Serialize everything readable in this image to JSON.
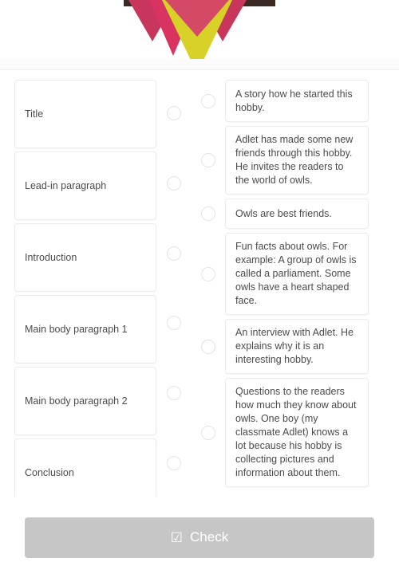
{
  "hero": {
    "image_alt": "party-bunting-banner-image",
    "colors": {
      "bar": "#3b2a23",
      "pennant_pink": "#c9365c",
      "pennant_pink_light": "#d44a66",
      "pennant_yellow": "#d7d128"
    }
  },
  "exercise": {
    "left_items": [
      {
        "label": "Title"
      },
      {
        "label": "Lead-in paragraph"
      },
      {
        "label": "Introduction"
      },
      {
        "label": "Main body paragraph 1"
      },
      {
        "label": "Main body paragraph 2"
      },
      {
        "label": "Conclusion"
      }
    ],
    "right_items": [
      {
        "label": "A story how he started this hobby."
      },
      {
        "label": "Adlet has made some new friends through this hobby. He invites the readers to the world of owls."
      },
      {
        "label": "Owls are best friends."
      },
      {
        "label": "Fun facts about owls. For example: A group of owls is called a parliament. Some owls have a heart shaped face."
      },
      {
        "label": "An interview with Adlet. He explains why it is an interesting hobby."
      },
      {
        "label": "Questions to the readers how much they know about owls. One boy (my classmate Adlet) knows a lot because his hobby is collecting pictures and information about them."
      }
    ]
  },
  "footer": {
    "check_label": "Check",
    "check_icon": "☑",
    "check_color": "#c6c6c6"
  }
}
